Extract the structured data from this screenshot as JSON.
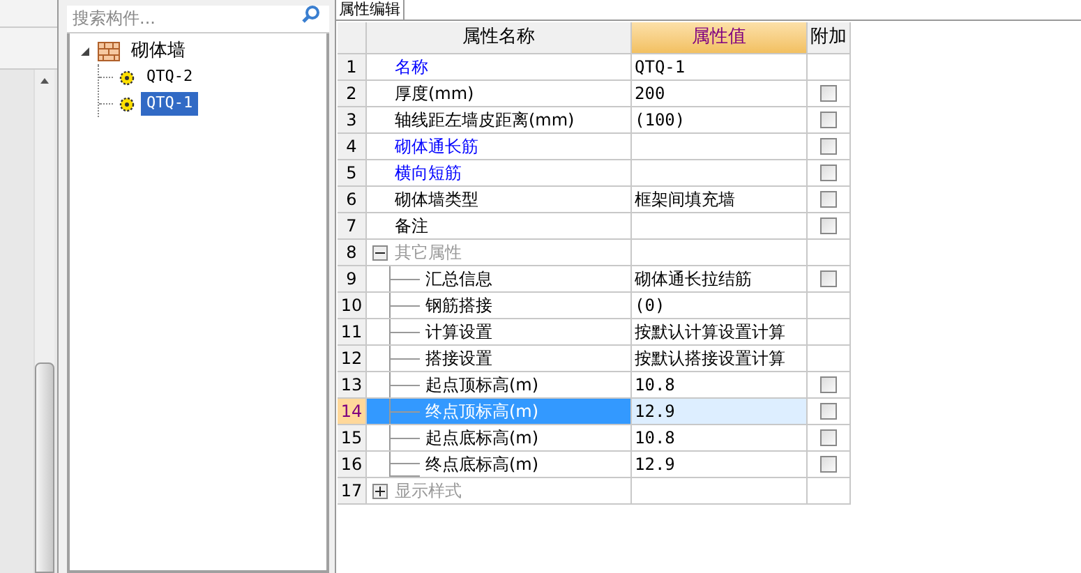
{
  "search": {
    "placeholder": "搜索构件..."
  },
  "tree": [
    {
      "label": "砌体墙",
      "kind": "folder",
      "expanded": true,
      "selected": false,
      "children": [
        {
          "label": "QTQ-2",
          "kind": "item",
          "selected": false
        },
        {
          "label": "QTQ-1",
          "kind": "item",
          "selected": true
        }
      ]
    }
  ],
  "tab": {
    "label": "属性编辑"
  },
  "table": {
    "columns": [
      "属性名称",
      "属性值",
      "附加"
    ],
    "rows": [
      {
        "index": "1",
        "kind": "property",
        "name": "名称",
        "color": "#0000ff",
        "value": "QTQ-1",
        "selected": false
      },
      {
        "index": "2",
        "kind": "property",
        "name": "厚度(mm)",
        "color": "#000000",
        "value": "200",
        "checked": false,
        "selected": false
      },
      {
        "index": "3",
        "kind": "property",
        "name": "轴线距左墙皮距离(mm)",
        "color": "#000000",
        "value": "(100)",
        "checked": false,
        "selected": false
      },
      {
        "index": "4",
        "kind": "property",
        "name": "砌体通长筋",
        "color": "#0000ff",
        "checked": false,
        "selected": false
      },
      {
        "index": "5",
        "kind": "property",
        "name": "横向短筋",
        "color": "#0000ff",
        "checked": false,
        "selected": false
      },
      {
        "index": "6",
        "kind": "property",
        "name": "砌体墙类型",
        "color": "#000000",
        "value": "框架间填充墙",
        "checked": false,
        "selected": false
      },
      {
        "index": "7",
        "kind": "property",
        "name": "备注",
        "color": "#000000",
        "checked": false,
        "selected": false
      },
      {
        "index": "8",
        "kind": "group",
        "name": "其它属性",
        "expanded": true,
        "selected": false,
        "children": [
          {
            "index": "9",
            "kind": "property",
            "name": "汇总信息",
            "color": "#000000",
            "value": "砌体通长拉结筋",
            "checked": false,
            "selected": false
          },
          {
            "index": "10",
            "kind": "property",
            "name": "钢筋搭接",
            "color": "#000000",
            "value": "(0)",
            "selected": false
          },
          {
            "index": "11",
            "kind": "property",
            "name": "计算设置",
            "color": "#000000",
            "value": "按默认计算设置计算",
            "selected": false
          },
          {
            "index": "12",
            "kind": "property",
            "name": "搭接设置",
            "color": "#000000",
            "value": "按默认搭接设置计算",
            "selected": false
          },
          {
            "index": "13",
            "kind": "property",
            "name": "起点顶标高(m)",
            "color": "#000000",
            "value": "10.8",
            "checked": false,
            "selected": false
          },
          {
            "index": "14",
            "kind": "property",
            "name": "终点顶标高(m)",
            "value": "12.9",
            "checked": false,
            "selected": true
          },
          {
            "index": "15",
            "kind": "property",
            "name": "起点底标高(m)",
            "color": "#000000",
            "value": "10.8",
            "checked": false,
            "selected": false
          },
          {
            "index": "16",
            "kind": "property",
            "name": "终点底标高(m)",
            "color": "#000000",
            "value": "12.9",
            "checked": false,
            "selected": false
          }
        ]
      },
      {
        "index": "17",
        "kind": "group",
        "name": "显示样式",
        "expanded": false,
        "selected": false
      }
    ]
  }
}
